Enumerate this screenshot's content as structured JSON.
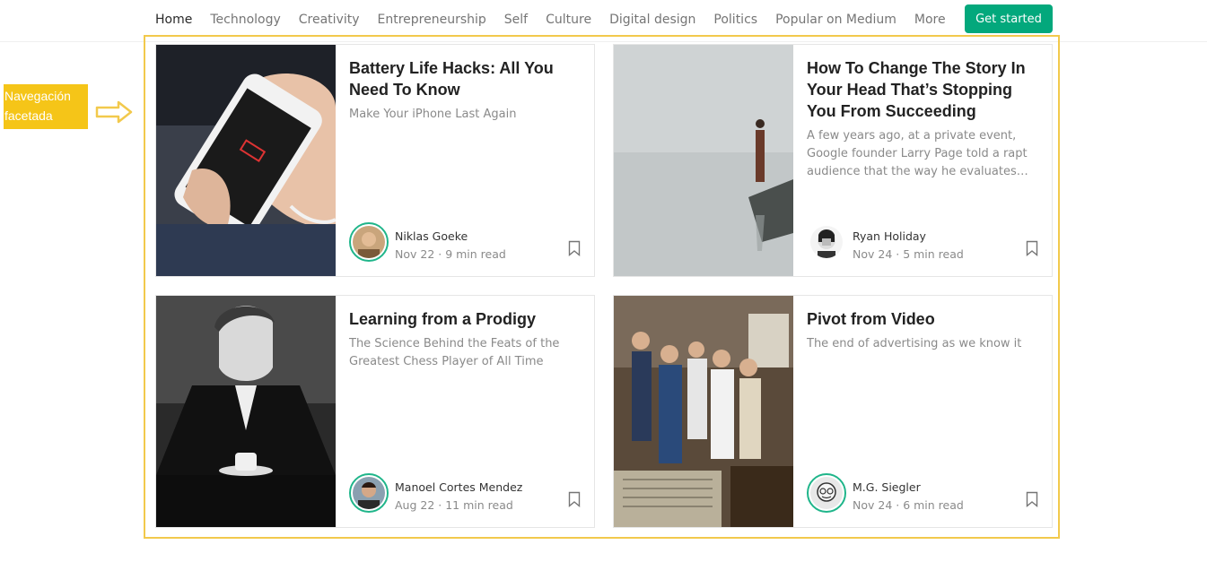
{
  "nav": {
    "items": [
      {
        "label": "Home",
        "active": true
      },
      {
        "label": "Technology"
      },
      {
        "label": "Creativity"
      },
      {
        "label": "Entrepreneurship"
      },
      {
        "label": "Self"
      },
      {
        "label": "Culture"
      },
      {
        "label": "Digital design"
      },
      {
        "label": "Politics"
      },
      {
        "label": "Popular on Medium"
      },
      {
        "label": "More"
      }
    ],
    "cta_label": "Get started"
  },
  "annotation": {
    "label_line1": "Navegación",
    "label_line2": "facetada"
  },
  "colors": {
    "accent": "#03a87c",
    "highlight": "#f2c94c",
    "annotation_bg": "#f5c518"
  },
  "articles": [
    {
      "title": "Battery Life Hacks: All You Need To Know",
      "subtitle": "Make Your iPhone Last Again",
      "author": "Niklas Goeke",
      "date": "Nov 22",
      "read_time": "9 min read",
      "image_icon": "phone-battery-photo"
    },
    {
      "title": "How To Change The Story In Your Head That’s Stopping You From Succeeding",
      "subtitle": "A few years ago, at a private event, Google founder Larry Page told a rapt audience that the way he evaluates…",
      "author": "Ryan Holiday",
      "date": "Nov 24",
      "read_time": "5 min read",
      "image_icon": "woman-on-rock-photo"
    },
    {
      "title": "Learning from a Prodigy",
      "subtitle": "The Science Behind the Feats of the Greatest Chess Player of All Time",
      "author": "Manoel Cortes Mendez",
      "date": "Aug 22",
      "read_time": "11 min read",
      "image_icon": "chess-player-photo"
    },
    {
      "title": "Pivot from Video",
      "subtitle": "The end of advertising as we know it",
      "author": "M.G. Siegler",
      "date": "Nov 24",
      "read_time": "6 min read",
      "image_icon": "group-tv-photo"
    }
  ]
}
